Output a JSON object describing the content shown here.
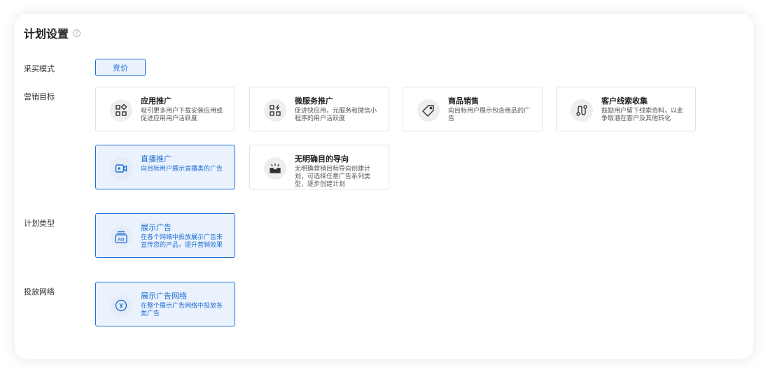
{
  "header": {
    "title": "计划设置",
    "help_icon": "question-circle-icon",
    "help_glyph": "?"
  },
  "purchase_mode": {
    "label": "采买模式",
    "option": "竞价"
  },
  "marketing_goal": {
    "label": "营销目标",
    "options": [
      {
        "title": "应用推广",
        "desc": "吸引更多用户下载安装应用或促进应用用户活跃度",
        "icon": "app-grid-icon"
      },
      {
        "title": "微服务推广",
        "desc": "促进快应用、元服务和微信小程序的用户活跃度",
        "icon": "micro-service-icon"
      },
      {
        "title": "商品销售",
        "desc": "向目标用户展示包含商品的广告",
        "icon": "tag-icon"
      },
      {
        "title": "客户线索收集",
        "desc": "鼓励用户留下线索资料，以此争取潜在客户及其他转化",
        "icon": "lead-path-icon"
      },
      {
        "title": "直播推广",
        "desc": "向目标用户展示直播类的广告",
        "icon": "live-camera-icon"
      },
      {
        "title": "无明确目的导向",
        "desc": "无明确营销目标导向创建计划，可选择任意广告系列类型，逐步创建计划",
        "icon": "inbox-icon"
      }
    ]
  },
  "plan_type": {
    "label": "计划类型",
    "option": {
      "title": "展示广告",
      "desc": "在各个网络中投放展示广告来宣传您的产品，提升营销效果",
      "icon": "ad-icon",
      "icon_text": "AD"
    }
  },
  "network": {
    "label": "投放网络",
    "option": {
      "title": "展示广告网络",
      "desc": "在整个展示广告网络中投放各类广告",
      "icon": "yuan-coin-icon",
      "icon_text": "¥"
    }
  },
  "colors": {
    "accent": "#1f6fd4",
    "selected_bg": "#eaf2fd",
    "border": "#e2e2e2"
  }
}
